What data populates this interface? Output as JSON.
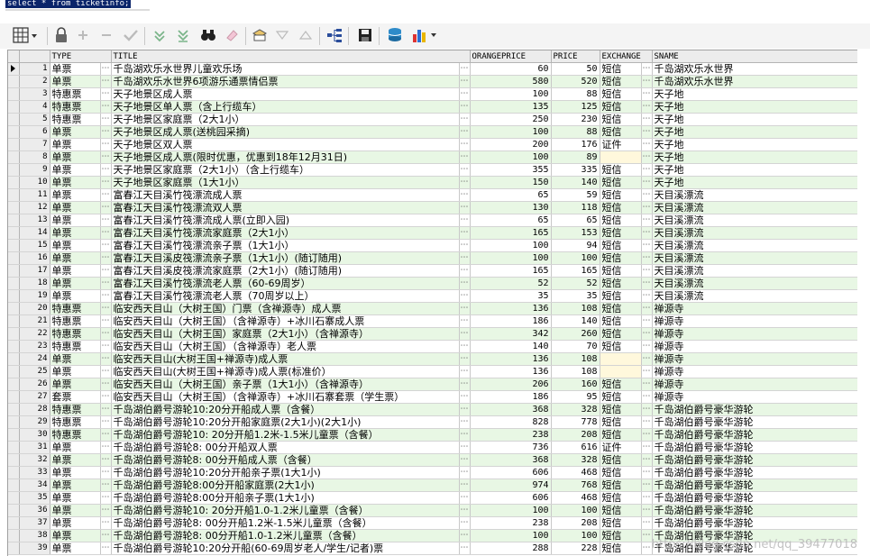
{
  "sql": {
    "text": "select * from ticketinfo;"
  },
  "toolbar": {
    "buttons": [
      "grid-view",
      "lock",
      "add",
      "remove",
      "post",
      "first",
      "last",
      "find",
      "clear",
      "query-by-example",
      "sort-down",
      "sort-up",
      "tree-view",
      "save",
      "export",
      "chart"
    ]
  },
  "grid": {
    "columns": [
      "TYPE",
      "TITLE",
      "ORANGEPRICE",
      "PRICE",
      "EXCHANGE",
      "SNAME"
    ],
    "rows": [
      [
        "1",
        "单票",
        "千岛湖欢乐水世界儿童欢乐场",
        "60",
        "50",
        "短信",
        "千岛湖欢乐水世界"
      ],
      [
        "2",
        "单票",
        "千岛湖欢乐水世界6项游乐通票情侣票",
        "580",
        "520",
        "短信",
        "千岛湖欢乐水世界"
      ],
      [
        "3",
        "特惠票",
        "天子地景区成人票",
        "100",
        "88",
        "短信",
        "天子地"
      ],
      [
        "4",
        "特惠票",
        "天子地景区单人票（含上行缆车）",
        "135",
        "125",
        "短信",
        "天子地"
      ],
      [
        "5",
        "特惠票",
        "天子地景区家庭票（2大1小）",
        "250",
        "230",
        "短信",
        "天子地"
      ],
      [
        "6",
        "单票",
        "天子地景区成人票(送桃园采摘)",
        "100",
        "88",
        "短信",
        "天子地"
      ],
      [
        "7",
        "单票",
        "天子地景区双人票",
        "200",
        "176",
        "证件",
        "天子地"
      ],
      [
        "8",
        "单票",
        "天子地景区成人票(限时优惠，优惠到18年12月31日)",
        "100",
        "89",
        "",
        "天子地"
      ],
      [
        "9",
        "单票",
        "天子地景区家庭票（2大1小）（含上行缆车）",
        "355",
        "335",
        "短信",
        "天子地"
      ],
      [
        "10",
        "单票",
        "天子地景区家庭票（1大1小）",
        "150",
        "140",
        "短信",
        "天子地"
      ],
      [
        "11",
        "单票",
        "富春江天目溪竹筏漂流成人票",
        "65",
        "59",
        "短信",
        "天目溪漂流"
      ],
      [
        "12",
        "单票",
        "富春江天目溪竹筏漂流双人票",
        "130",
        "118",
        "短信",
        "天目溪漂流"
      ],
      [
        "13",
        "单票",
        "富春江天目溪竹筏漂流成人票(立即入园)",
        "65",
        "65",
        "短信",
        "天目溪漂流"
      ],
      [
        "14",
        "单票",
        "富春江天目溪竹筏漂流家庭票（2大1小）",
        "165",
        "153",
        "短信",
        "天目溪漂流"
      ],
      [
        "15",
        "单票",
        "富春江天目溪竹筏漂流亲子票（1大1小）",
        "100",
        "94",
        "短信",
        "天目溪漂流"
      ],
      [
        "16",
        "单票",
        "富春江天目溪皮筏漂流亲子票（1大1小）(随订随用)",
        "100",
        "100",
        "短信",
        "天目溪漂流"
      ],
      [
        "17",
        "单票",
        "富春江天目溪皮筏漂流家庭票（2大1小）(随订随用)",
        "165",
        "165",
        "短信",
        "天目溪漂流"
      ],
      [
        "18",
        "单票",
        "富春江天目溪竹筏漂流老人票（60-69周岁）",
        "52",
        "52",
        "短信",
        "天目溪漂流"
      ],
      [
        "19",
        "单票",
        "富春江天目溪竹筏漂流老人票（70周岁以上）",
        "35",
        "35",
        "短信",
        "天目溪漂流"
      ],
      [
        "20",
        "特惠票",
        "临安西天目山（大树王国）门票（含禅源寺）成人票",
        "136",
        "108",
        "短信",
        "禅源寺"
      ],
      [
        "21",
        "特惠票",
        "临安西天目山（大树王国）（含禅源寺）+冰川石寨成人票",
        "186",
        "140",
        "短信",
        "禅源寺"
      ],
      [
        "22",
        "特惠票",
        "临安西天目山（大树王国）家庭票（2大1小）（含禅源寺）",
        "342",
        "260",
        "短信",
        "禅源寺"
      ],
      [
        "23",
        "特惠票",
        "临安西天目山（大树王国）（含禅源寺）老人票",
        "140",
        "70",
        "短信",
        "禅源寺"
      ],
      [
        "24",
        "单票",
        "临安西天目山(大树王国+禅源寺)成人票",
        "136",
        "108",
        "",
        "禅源寺"
      ],
      [
        "25",
        "单票",
        "临安西天目山(大树王国+禅源寺)成人票(标准价）",
        "136",
        "108",
        "",
        "禅源寺"
      ],
      [
        "26",
        "单票",
        "临安西天目山（大树王国）亲子票（1大1小）（含禅源寺）",
        "206",
        "160",
        "短信",
        "禅源寺"
      ],
      [
        "27",
        "套票",
        "临安西天目山（大树王国）（含禅源寺）+冰川石寨套票（学生票）",
        "186",
        "95",
        "短信",
        "禅源寺"
      ],
      [
        "28",
        "特惠票",
        "千岛湖伯爵号游轮10:20分开船成人票（含餐）",
        "368",
        "328",
        "短信",
        "千岛湖伯爵号豪华游轮"
      ],
      [
        "29",
        "特惠票",
        "千岛湖伯爵号游轮10:20分开船家庭票(2大1小)(2大1小)",
        "828",
        "778",
        "短信",
        "千岛湖伯爵号豪华游轮"
      ],
      [
        "30",
        "特惠票",
        "千岛湖伯爵号游轮10: 20分开船1.2米-1.5米儿童票（含餐）",
        "238",
        "208",
        "短信",
        "千岛湖伯爵号豪华游轮"
      ],
      [
        "31",
        "单票",
        "千岛湖伯爵号游轮8: 00分开船双人票",
        "736",
        "616",
        "证件",
        "千岛湖伯爵号豪华游轮"
      ],
      [
        "32",
        "单票",
        "千岛湖伯爵号游轮8: 00分开船成人票（含餐）",
        "368",
        "328",
        "短信",
        "千岛湖伯爵号豪华游轮"
      ],
      [
        "33",
        "单票",
        "千岛湖伯爵号游轮10:20分开船亲子票(1大1小)",
        "606",
        "468",
        "短信",
        "千岛湖伯爵号豪华游轮"
      ],
      [
        "34",
        "单票",
        "千岛湖伯爵号游轮8:00分开船家庭票(2大1小)",
        "974",
        "768",
        "短信",
        "千岛湖伯爵号豪华游轮"
      ],
      [
        "35",
        "单票",
        "千岛湖伯爵号游轮8:00分开船亲子票(1大1小)",
        "606",
        "468",
        "短信",
        "千岛湖伯爵号豪华游轮"
      ],
      [
        "36",
        "单票",
        "千岛湖伯爵号游轮10: 20分开船1.0-1.2米儿童票（含餐）",
        "100",
        "100",
        "短信",
        "千岛湖伯爵号豪华游轮"
      ],
      [
        "37",
        "单票",
        "千岛湖伯爵号游轮8: 00分开船1.2米-1.5米儿童票（含餐）",
        "238",
        "208",
        "短信",
        "千岛湖伯爵号豪华游轮"
      ],
      [
        "38",
        "单票",
        "千岛湖伯爵号游轮8: 00分开船1.0-1.2米儿童票（含餐）",
        "100",
        "100",
        "短信",
        "千岛湖伯爵号豪华游轮"
      ],
      [
        "39",
        "单票",
        "千岛湖伯爵号游轮10:20分开船(60-69周岁老人/学生/记者)票",
        "288",
        "228",
        "短信",
        "千岛湖伯爵号豪华游轮"
      ]
    ]
  },
  "watermark": {
    "text": "https://blog.csdn.net/qq_39477018"
  },
  "colors": {
    "row_alt": "#e8f7e4",
    "selection": "#0a246a",
    "header_bg": "#ececec"
  }
}
